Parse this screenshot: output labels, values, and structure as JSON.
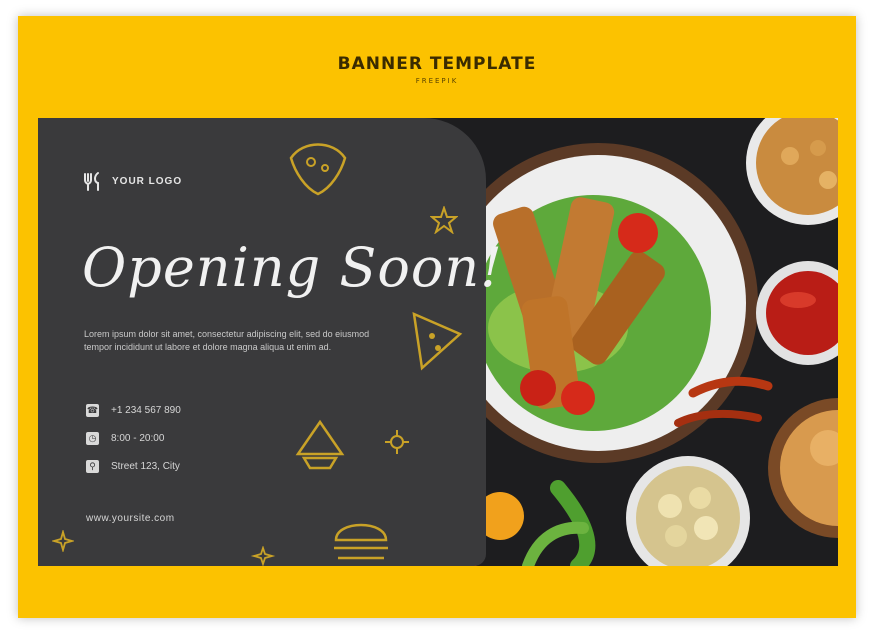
{
  "header": {
    "title": "BANNER TEMPLATE",
    "subtitle": "FREEPIK"
  },
  "banner": {
    "logo_text": "YOUR LOGO",
    "headline": "Opening Soon!",
    "body_text": "Lorem ipsum dolor sit amet, consectetur adipiscing elit, sed do eiusmod tempor incididunt ut labore et dolore magna aliqua ut enim ad.",
    "contacts": [
      {
        "icon": "phone-icon",
        "text": "+1 234 567 890"
      },
      {
        "icon": "clock-icon",
        "text": "8:00 - 20:00"
      },
      {
        "icon": "location-icon",
        "text": "Street 123, City"
      }
    ],
    "website": "www.yoursite.com",
    "food": "fried chicken strips on salad with tomatoes and dipping sauces"
  },
  "colors": {
    "accent_yellow": "#fcc200",
    "panel_dark": "#3a3a3c",
    "photo_background": "#1d1d1f",
    "doodle_gold": "#c9a227"
  }
}
